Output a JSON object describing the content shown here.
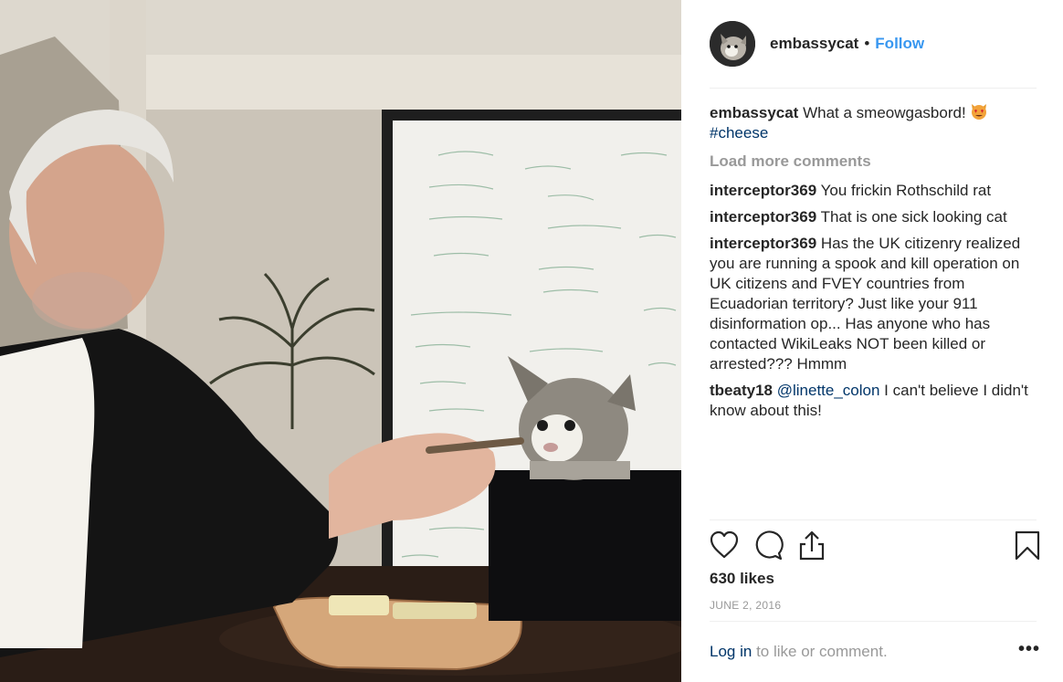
{
  "post": {
    "username": "embassycat",
    "separator": "•",
    "follow_label": "Follow",
    "caption": {
      "user": "embassycat",
      "text": "What a smeowgasbord!",
      "emoji": "heart-eyes-cat-emoji",
      "hashtag": "#cheese"
    },
    "load_more_label": "Load more comments",
    "comments": [
      {
        "user": "interceptor369",
        "text": "You frickin Rothschild rat"
      },
      {
        "user": "interceptor369",
        "text": "That is one sick looking cat"
      },
      {
        "user": "interceptor369",
        "text": "Has the UK citizenry realized you are running a spook and kill operation on UK citizens and FVEY countries from Ecuadorian territory? Just like your 911 disinformation op... Has anyone who has contacted WikiLeaks NOT been killed or arrested??? Hmmm"
      }
    ],
    "mention_comment": {
      "user": "tbeaty18",
      "mention": "@linette_colon",
      "text": "I can't believe I didn't know about this!"
    },
    "likes_label": "630 likes",
    "date_label": "JUNE 2, 2016",
    "login_link": "Log in",
    "login_suffix": "to like or comment.",
    "more_label": "•••"
  },
  "icons": [
    "heart-icon",
    "comment-icon",
    "share-icon",
    "bookmark-icon",
    "more-options-icon"
  ],
  "colors": {
    "link": "#3897f0",
    "text": "#262626",
    "muted": "#999999",
    "dark_link": "#003569",
    "divider": "#efefef"
  }
}
